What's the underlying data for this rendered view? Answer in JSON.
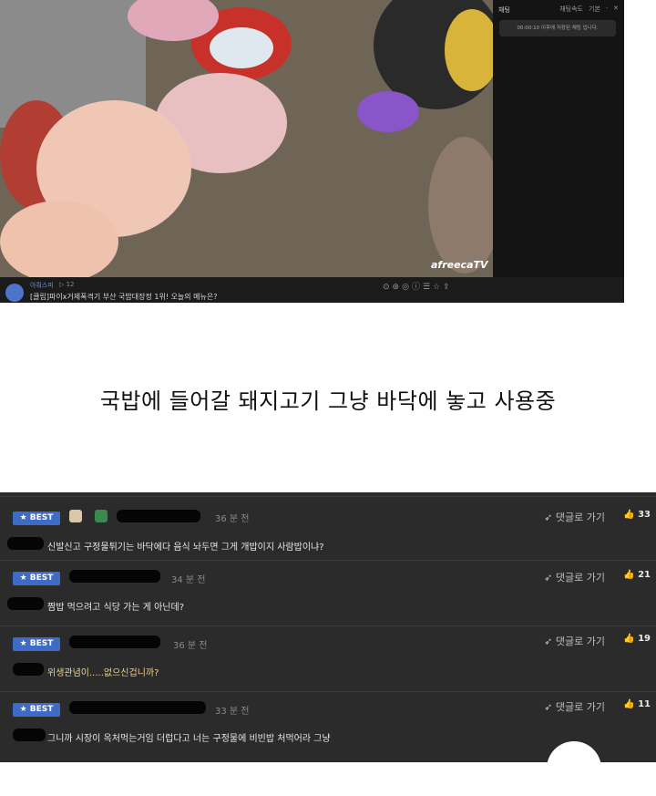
{
  "chat": {
    "title": "채팅",
    "controls": [
      "채팅속도",
      "기본",
      "·",
      "✕"
    ],
    "notice": "00:00:10 이후에 저장된 채팅 입니다."
  },
  "stream": {
    "streamer": "아줘스피",
    "viewers": "▷ 12",
    "title": "[클립]파이x거제폭격기 부산 국밥대장정 1위! 오늘의 메뉴은?",
    "logo": "afreecaTV"
  },
  "caption": "국밥에 들어갈 돼지고기 그냥 바닥에 놓고 사용중",
  "comments": [
    {
      "badge": "★ BEST",
      "time": "36 분 전",
      "reply": "댓글로 가기",
      "likes": "33",
      "body": "신발신고 구정물튀기는 바닥에다 음식 놔두면 그게 개밥이지 사람밥이냐?"
    },
    {
      "badge": "★ BEST",
      "time": "34 분 전",
      "reply": "댓글로 가기",
      "likes": "21",
      "body": "짬밥 먹으려고 식당 가는 게 아닌데?"
    },
    {
      "badge": "★ BEST",
      "time": "36 분 전",
      "reply": "댓글로 가기",
      "likes": "19",
      "body": "위생관념이.....없으신겁니까?"
    },
    {
      "badge": "★ BEST",
      "time": "33 분 전",
      "reply": "댓글로 가기",
      "likes": "11",
      "body": "그니까 시장이 옥처먹는거임 더럽다고 너는 구정물에 비빈밥 처먹어라 그냥"
    }
  ],
  "icons": {
    "reply": "reply-arrow-icon",
    "like": "thumbs-up-icon"
  },
  "colors": {
    "best_badge": "#3d6bc5",
    "comment_bg": "#2b2b2b"
  }
}
